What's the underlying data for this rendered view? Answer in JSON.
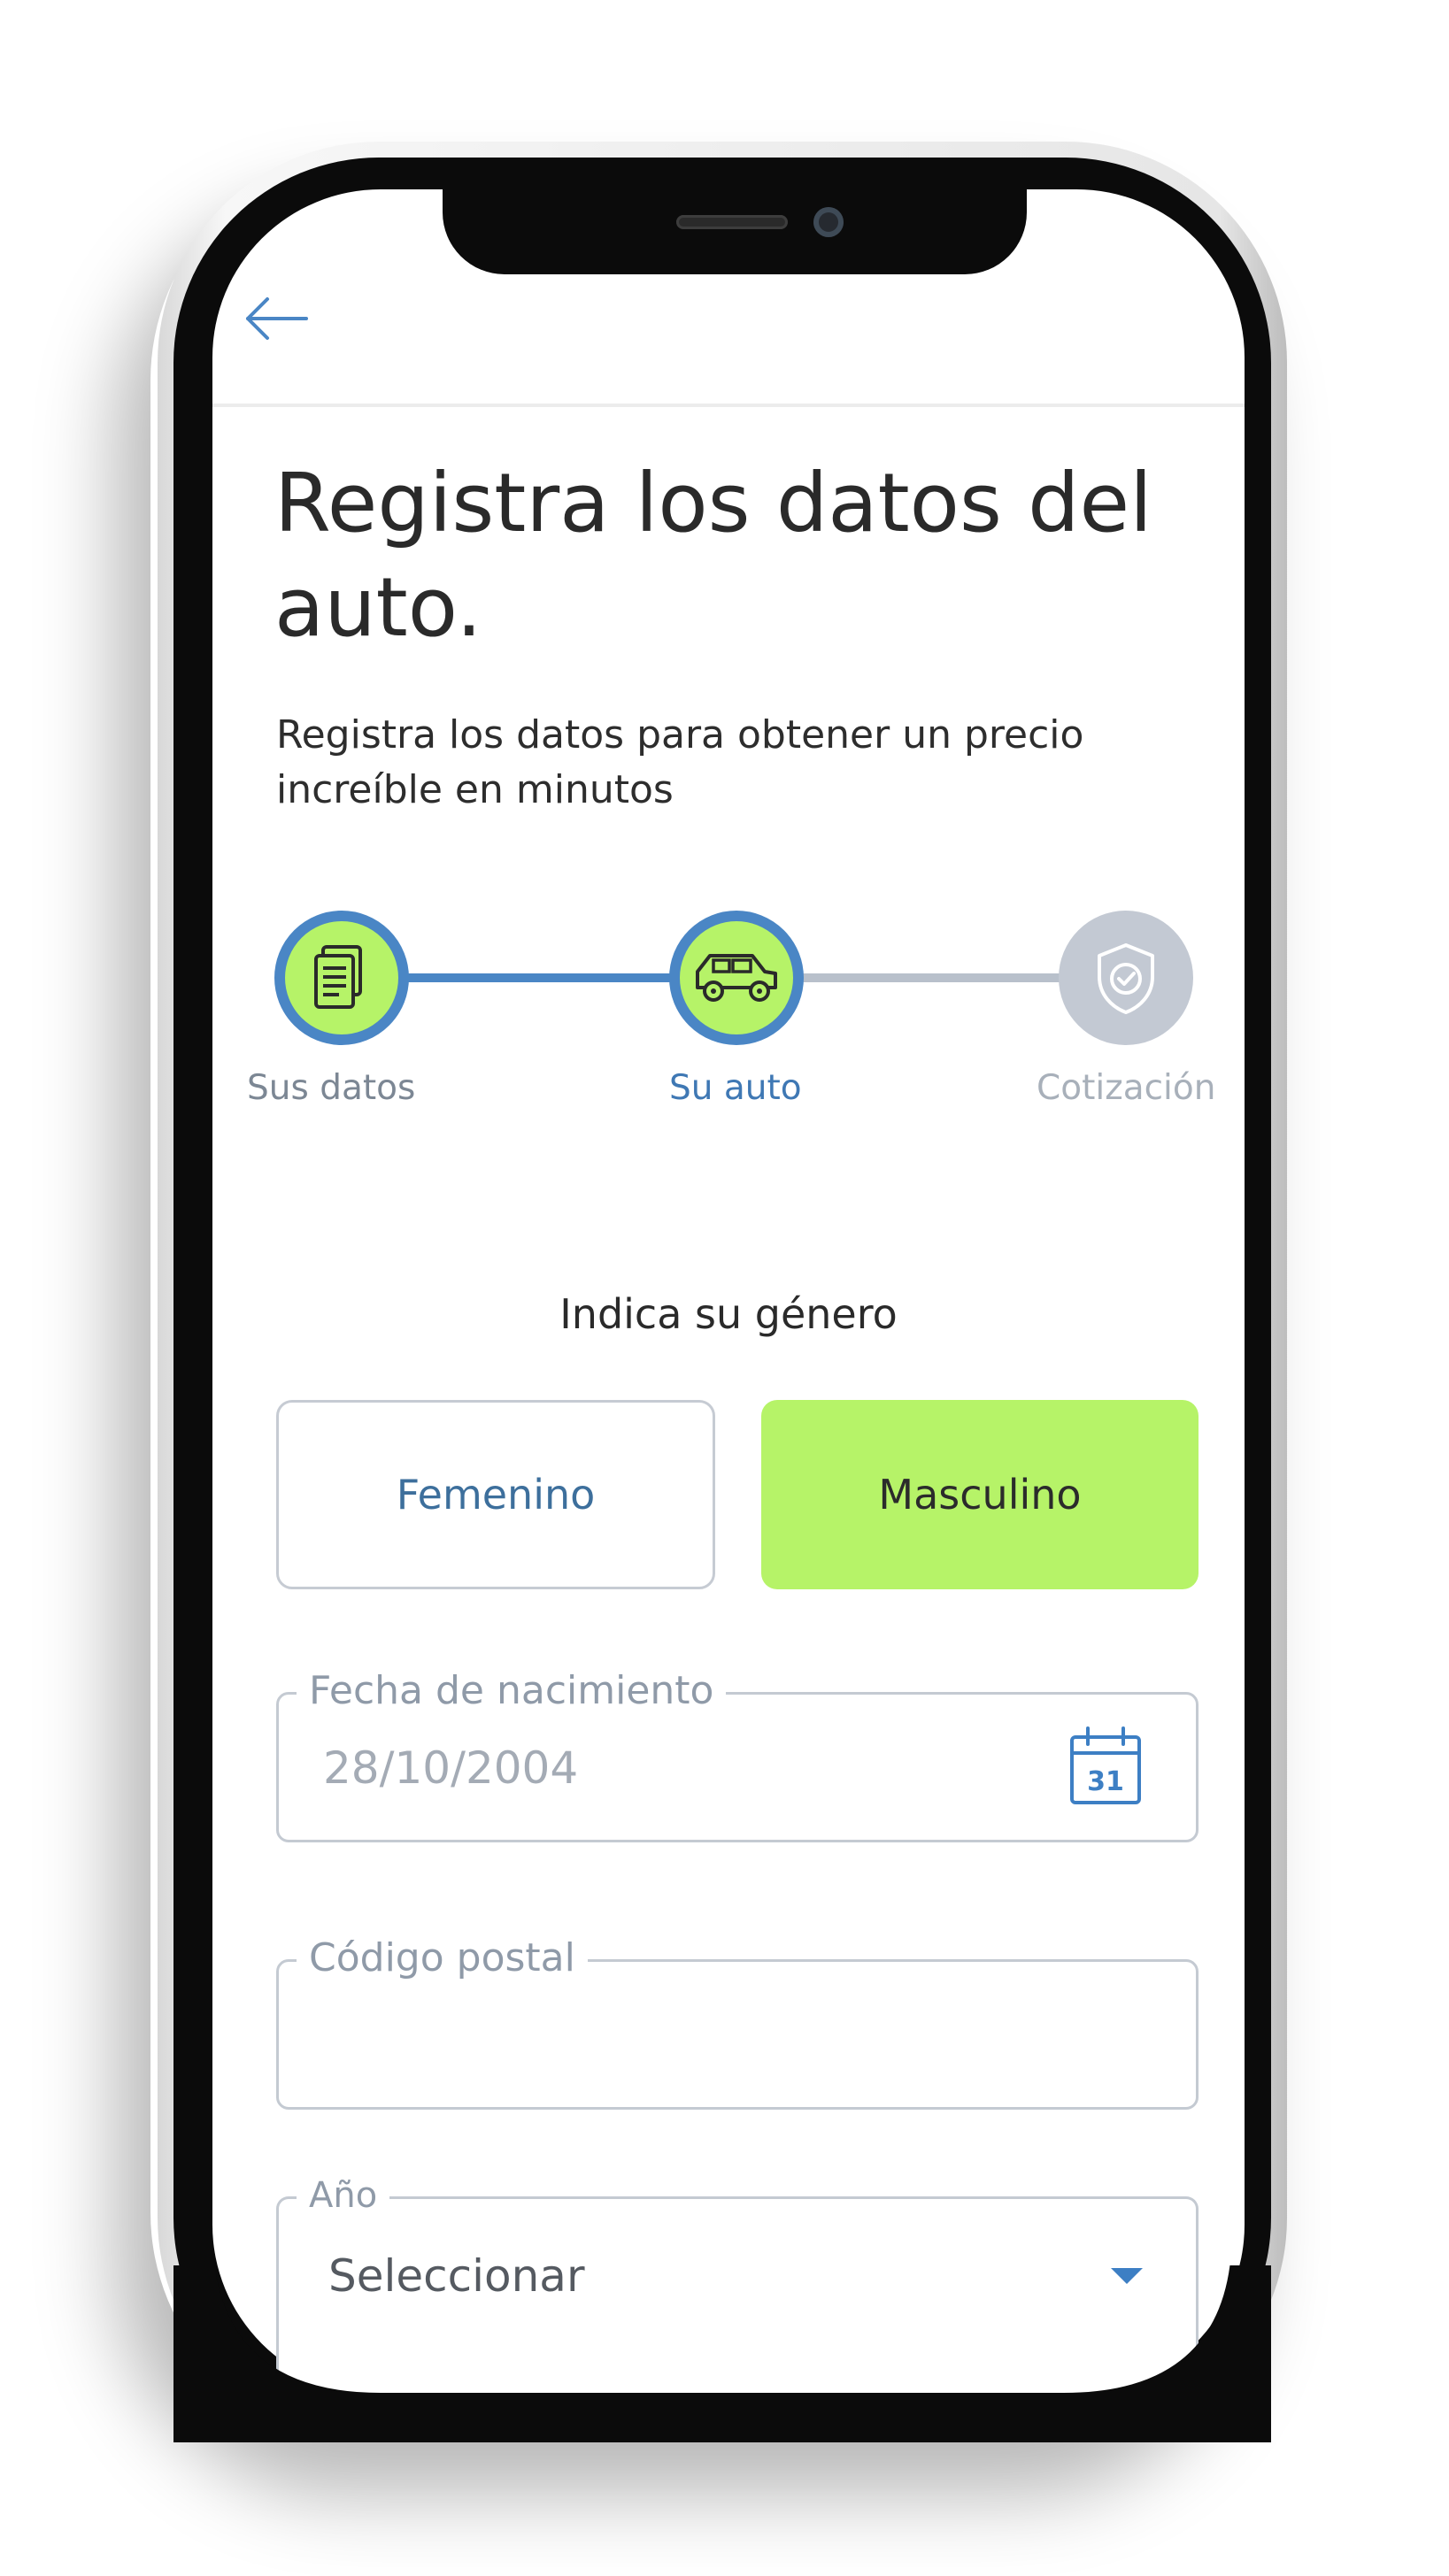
{
  "header": {
    "back_icon": "arrow-left-icon"
  },
  "main": {
    "title": "Registra los datos del auto.",
    "subtitle": "Registra los datos para obtener un precio increíble en minutos"
  },
  "stepper": {
    "steps": [
      {
        "label": "Sus datos",
        "icon": "document-icon",
        "state": "done"
      },
      {
        "label": "Su auto",
        "icon": "car-icon",
        "state": "active"
      },
      {
        "label": "Cotización",
        "icon": "shield-check-icon",
        "state": "pending"
      }
    ]
  },
  "gender": {
    "label": "Indica su género",
    "options": [
      {
        "label": "Femenino",
        "selected": false
      },
      {
        "label": "Masculino",
        "selected": true
      }
    ]
  },
  "form": {
    "birthdate": {
      "label": "Fecha de nacimiento",
      "placeholder": "28/10/2004",
      "calendar_day": "31"
    },
    "postal_code": {
      "label": "Código postal",
      "value": ""
    },
    "year": {
      "label": "Año",
      "selected": "Seleccionar"
    }
  },
  "colors": {
    "accent_blue": "#4a86c5",
    "accent_green": "#b6f368",
    "inactive_gray": "#c3c9d3",
    "text_dark": "#2a2a2a"
  }
}
